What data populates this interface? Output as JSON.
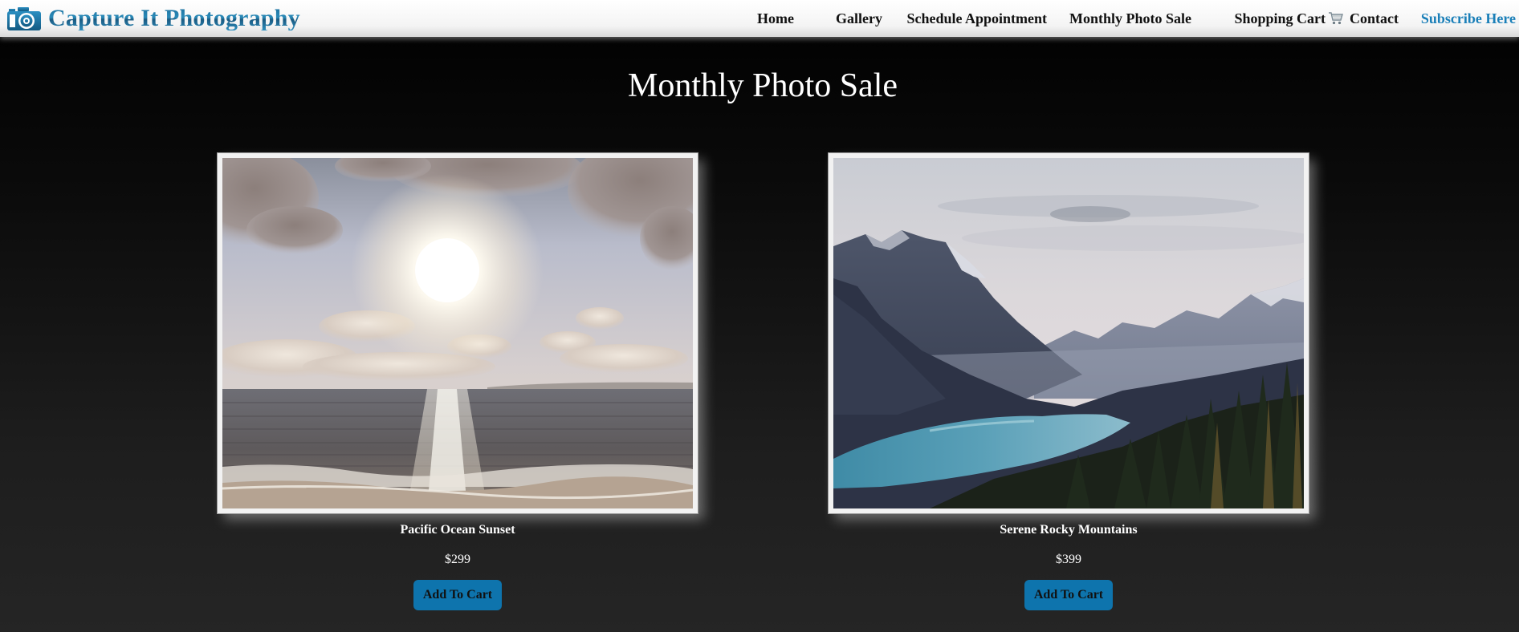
{
  "header": {
    "brand_name": "Capture It Photography",
    "logo_icon": "camera-icon",
    "accent_color": "#1a7fb8"
  },
  "nav": {
    "items": [
      {
        "label": "Home"
      },
      {
        "label": "Gallery"
      },
      {
        "label": "Schedule Appointment"
      },
      {
        "label": "Monthly Photo Sale"
      },
      {
        "label": "Shopping Cart",
        "icon": "shopping-cart-icon"
      },
      {
        "label": "Contact"
      },
      {
        "label": "Subscribe Here"
      }
    ]
  },
  "main": {
    "title": "Monthly Photo Sale",
    "products": [
      {
        "name": "Pacific Ocean Sunset",
        "price": "$299",
        "button_label": "Add To Cart",
        "image": "ocean-sunset-photo"
      },
      {
        "name": "Serene Rocky Mountains",
        "price": "$399",
        "button_label": "Add To Cart",
        "image": "mountain-lake-photo"
      }
    ]
  },
  "colors": {
    "button_bg": "#0e74ad",
    "subscribe_link": "#1a7fb8"
  }
}
